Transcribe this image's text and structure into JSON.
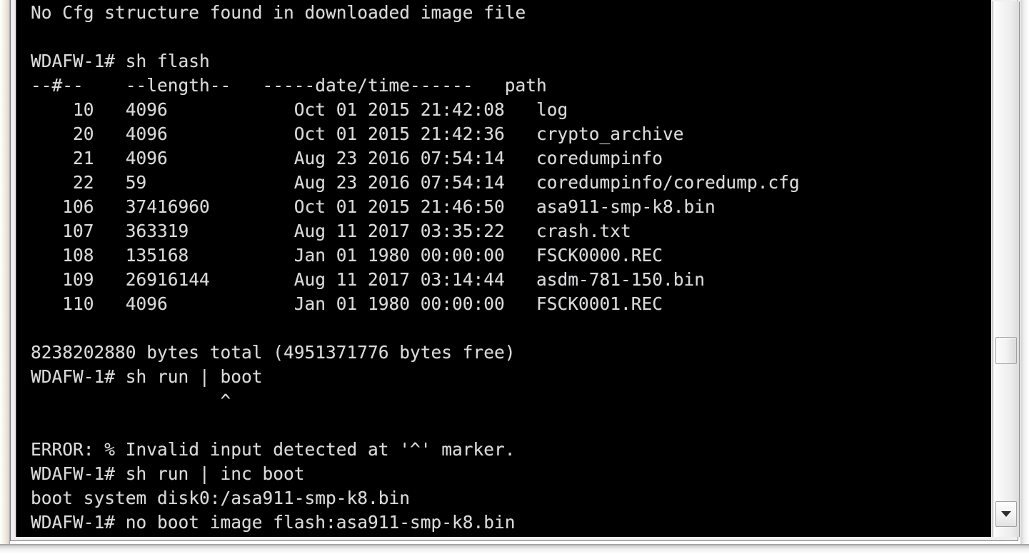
{
  "window": {
    "type": "terminal-console",
    "background_color": "#000000",
    "text_color": "#d9d9d9"
  },
  "terminal": {
    "prompt": "WDAFW-1#",
    "lines": [
      "No Cfg structure found in downloaded image file",
      "",
      "WDAFW-1# sh flash",
      "--#--    --length--   -----date/time------   path",
      "    10   4096            Oct 01 2015 21:42:08   log",
      "    20   4096            Oct 01 2015 21:42:36   crypto_archive",
      "    21   4096            Aug 23 2016 07:54:14   coredumpinfo",
      "    22   59              Aug 23 2016 07:54:14   coredumpinfo/coredump.cfg",
      "   106   37416960        Oct 01 2015 21:46:50   asa911-smp-k8.bin",
      "   107   363319          Aug 11 2017 03:35:22   crash.txt",
      "   108   135168          Jan 01 1980 00:00:00   FSCK0000.REC",
      "   109   26916144        Aug 11 2017 03:14:44   asdm-781-150.bin",
      "   110   4096            Jan 01 1980 00:00:00   FSCK0001.REC",
      "",
      "8238202880 bytes total (4951371776 bytes free)",
      "WDAFW-1# sh run | boot",
      "                  ^",
      "",
      "ERROR: % Invalid input detected at '^' marker.",
      "WDAFW-1# sh run | inc boot",
      "boot system disk0:/asa911-smp-k8.bin",
      "WDAFW-1# no boot image flash:asa911-smp-k8.bin",
      "           ^"
    ],
    "flash_listing": {
      "headers": [
        "--#--",
        "--length--",
        "-----date/time------",
        "path"
      ],
      "rows": [
        {
          "num": "10",
          "length": "4096",
          "date": "Oct 01 2015 21:42:08",
          "path": "log"
        },
        {
          "num": "20",
          "length": "4096",
          "date": "Oct 01 2015 21:42:36",
          "path": "crypto_archive"
        },
        {
          "num": "21",
          "length": "4096",
          "date": "Aug 23 2016 07:54:14",
          "path": "coredumpinfo"
        },
        {
          "num": "22",
          "length": "59",
          "date": "Aug 23 2016 07:54:14",
          "path": "coredumpinfo/coredump.cfg"
        },
        {
          "num": "106",
          "length": "37416960",
          "date": "Oct 01 2015 21:46:50",
          "path": "asa911-smp-k8.bin"
        },
        {
          "num": "107",
          "length": "363319",
          "date": "Aug 11 2017 03:35:22",
          "path": "crash.txt"
        },
        {
          "num": "108",
          "length": "135168",
          "date": "Jan 01 1980 00:00:00",
          "path": "FSCK0000.REC"
        },
        {
          "num": "109",
          "length": "26916144",
          "date": "Aug 11 2017 03:14:44",
          "path": "asdm-781-150.bin"
        },
        {
          "num": "110",
          "length": "4096",
          "date": "Jan 01 1980 00:00:00",
          "path": "FSCK0001.REC"
        }
      ],
      "summary": "8238202880 bytes total (4951371776 bytes free)",
      "total_bytes": "8238202880",
      "free_bytes": "4951371776"
    },
    "commands": [
      "sh flash",
      "sh run | boot",
      "sh run | inc boot",
      "no boot image flash:asa911-smp-k8.bin"
    ],
    "error_message": "ERROR: % Invalid input detected at '^' marker.",
    "boot_config": "boot system disk0:/asa911-smp-k8.bin",
    "header_message": "No Cfg structure found in downloaded image file"
  },
  "scrollbar": {
    "orientation": "vertical",
    "thumb_position_pct": 63,
    "down_arrow_icon": "chevron-down-icon"
  }
}
